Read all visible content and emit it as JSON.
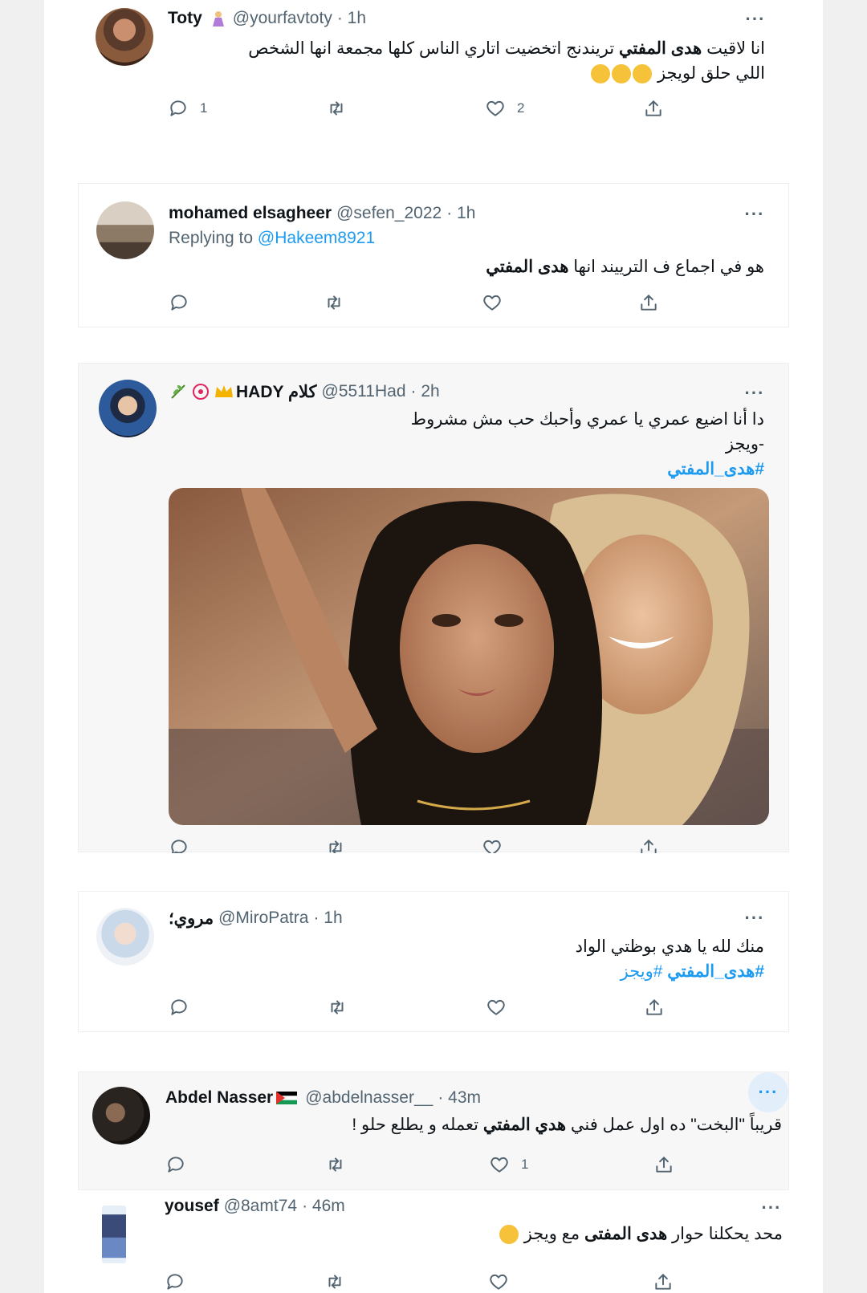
{
  "colors": {
    "accent": "#1d9bf0",
    "muted": "#536471",
    "text": "#0f1419"
  },
  "icons": {
    "reply": "reply-icon",
    "retweet": "retweet-icon",
    "like": "heart-icon",
    "share": "share-icon",
    "more": "more-icon"
  },
  "tweets": [
    {
      "name": "Toty",
      "handle": "@yourfavtoty",
      "time": "· 1h",
      "more": "···",
      "text_pre": "انا لاقيت",
      "text_bold": "هدى المفتي",
      "text_post": "تريندنج اتخضيت اتاري الناس كلها مجمعة انها الشخص",
      "text_line2": "اللي حلق لويجز",
      "reply_count": "1",
      "retweet_count": "",
      "like_count": "2"
    },
    {
      "name": "mohamed elsagheer",
      "handle": "@sefen_2022",
      "time": "· 1h",
      "more": "···",
      "replying_label": "Replying to",
      "replying_handle": "@Hakeem8921",
      "text_pre": "هو في اجماع ف الترييند انها",
      "text_bold": "هدى المفتي",
      "reply_count": "",
      "retweet_count": "",
      "like_count": ""
    },
    {
      "name": "HADY كلام",
      "handle": "@5511Had",
      "time": "· 2h",
      "more": "···",
      "text_line1": "دا أنا اضيع عمري يا عمري وأحبك حب مش مشروط",
      "text_line2": "-ويجز",
      "hashtag": "#هدى_المفتي",
      "reply_count": "",
      "retweet_count": "",
      "like_count": ""
    },
    {
      "name": "مروي؛",
      "handle": "@MiroPatra",
      "time": "· 1h",
      "more": "···",
      "text_line1": "منك لله يا هدي بوظتي الواد",
      "hashtag1": "#هدى_المفتي",
      "hashtag2": "#ويجز",
      "reply_count": "",
      "retweet_count": "",
      "like_count": ""
    },
    {
      "name": "Abdel Nasser",
      "handle": "@abdelnasser__",
      "time": "· 43m",
      "more": "···",
      "text_pre": "قريباً \"البخت\" ده اول عمل فني",
      "text_bold": "هدي المفتي",
      "text_post": "تعمله و يطلع حلو !",
      "reply_count": "",
      "retweet_count": "",
      "like_count": "1"
    },
    {
      "name": "yousef",
      "handle": "@8amt74",
      "time": "· 46m",
      "more": "···",
      "text_pre": "محد يحكلنا حوار",
      "text_bold": "هدى المفتى",
      "text_post": "مع ويجز",
      "reply_count": "",
      "retweet_count": "",
      "like_count": ""
    }
  ]
}
